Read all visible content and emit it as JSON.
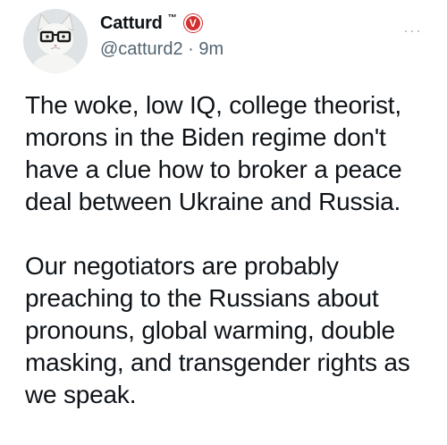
{
  "author": {
    "display_name": "Catturd",
    "tm": "™",
    "badge_letter": "V",
    "handle": "@catturd2",
    "separator": "·",
    "time": "9m"
  },
  "actions": {
    "more_label": "···"
  },
  "tweet": {
    "paragraphs": [
      "The woke, low IQ, college theorist, morons in the Biden regime don't have a clue how to broker a peace deal between Ukraine and Russia.",
      "Our negotiators are probably preaching to the Russians about pronouns, global warming, double masking, and transgender rights as we speak."
    ]
  },
  "colors": {
    "text": "#0f1419",
    "muted": "#536471",
    "badge": "#d32f2f",
    "background": "#ffffff"
  },
  "icons": {
    "avatar": "cat-with-glasses-avatar",
    "badge": "verified-badge-icon",
    "more": "more-options-icon"
  }
}
